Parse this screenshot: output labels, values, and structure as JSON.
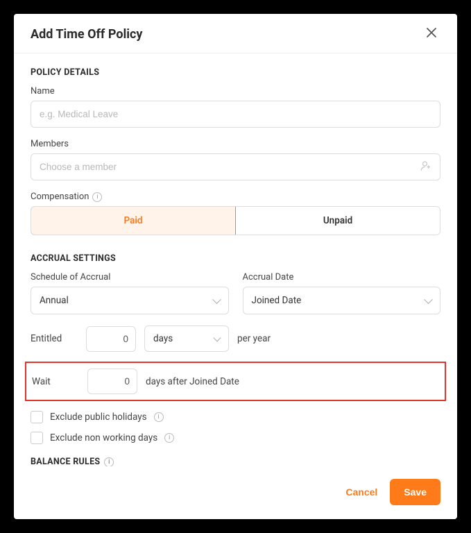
{
  "header": {
    "title": "Add Time Off Policy"
  },
  "policy": {
    "section_title": "POLICY DETAILS",
    "name_label": "Name",
    "name_placeholder": "e.g. Medical Leave",
    "members_label": "Members",
    "members_placeholder": "Choose a member",
    "compensation_label": "Compensation",
    "paid_label": "Paid",
    "unpaid_label": "Unpaid",
    "compensation_selected": "Paid"
  },
  "accrual": {
    "section_title": "ACCRUAL SETTINGS",
    "schedule_label": "Schedule of Accrual",
    "schedule_value": "Annual",
    "accrual_date_label": "Accrual Date",
    "accrual_date_value": "Joined Date",
    "entitled_label": "Entitled",
    "entitled_value": "0",
    "entitled_unit": "days",
    "entitled_suffix": "per year",
    "wait_label": "Wait",
    "wait_value": "0",
    "wait_suffix": "days after Joined Date",
    "exclude_holidays_label": "Exclude public holidays",
    "exclude_nonworking_label": "Exclude non working days"
  },
  "balance": {
    "section_title": "BALANCE RULES"
  },
  "footer": {
    "cancel_label": "Cancel",
    "save_label": "Save"
  }
}
